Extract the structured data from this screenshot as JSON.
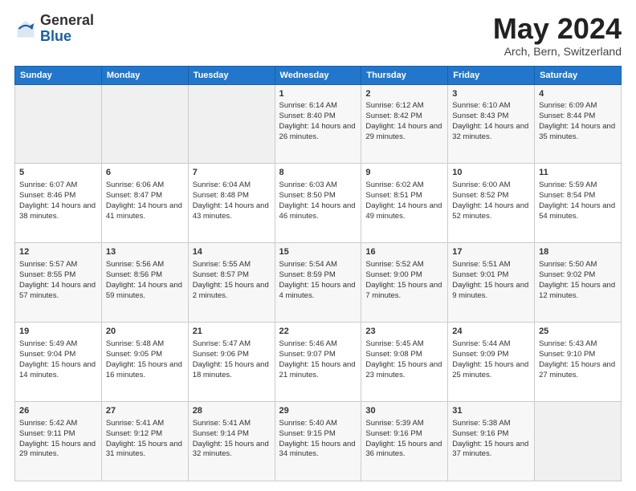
{
  "header": {
    "logo_general": "General",
    "logo_blue": "Blue",
    "month_title": "May 2024",
    "location": "Arch, Bern, Switzerland"
  },
  "days_of_week": [
    "Sunday",
    "Monday",
    "Tuesday",
    "Wednesday",
    "Thursday",
    "Friday",
    "Saturday"
  ],
  "weeks": [
    [
      {
        "day": "",
        "content": ""
      },
      {
        "day": "",
        "content": ""
      },
      {
        "day": "",
        "content": ""
      },
      {
        "day": "1",
        "content": "Sunrise: 6:14 AM\nSunset: 8:40 PM\nDaylight: 14 hours and 26 minutes."
      },
      {
        "day": "2",
        "content": "Sunrise: 6:12 AM\nSunset: 8:42 PM\nDaylight: 14 hours and 29 minutes."
      },
      {
        "day": "3",
        "content": "Sunrise: 6:10 AM\nSunset: 8:43 PM\nDaylight: 14 hours and 32 minutes."
      },
      {
        "day": "4",
        "content": "Sunrise: 6:09 AM\nSunset: 8:44 PM\nDaylight: 14 hours and 35 minutes."
      }
    ],
    [
      {
        "day": "5",
        "content": "Sunrise: 6:07 AM\nSunset: 8:46 PM\nDaylight: 14 hours and 38 minutes."
      },
      {
        "day": "6",
        "content": "Sunrise: 6:06 AM\nSunset: 8:47 PM\nDaylight: 14 hours and 41 minutes."
      },
      {
        "day": "7",
        "content": "Sunrise: 6:04 AM\nSunset: 8:48 PM\nDaylight: 14 hours and 43 minutes."
      },
      {
        "day": "8",
        "content": "Sunrise: 6:03 AM\nSunset: 8:50 PM\nDaylight: 14 hours and 46 minutes."
      },
      {
        "day": "9",
        "content": "Sunrise: 6:02 AM\nSunset: 8:51 PM\nDaylight: 14 hours and 49 minutes."
      },
      {
        "day": "10",
        "content": "Sunrise: 6:00 AM\nSunset: 8:52 PM\nDaylight: 14 hours and 52 minutes."
      },
      {
        "day": "11",
        "content": "Sunrise: 5:59 AM\nSunset: 8:54 PM\nDaylight: 14 hours and 54 minutes."
      }
    ],
    [
      {
        "day": "12",
        "content": "Sunrise: 5:57 AM\nSunset: 8:55 PM\nDaylight: 14 hours and 57 minutes."
      },
      {
        "day": "13",
        "content": "Sunrise: 5:56 AM\nSunset: 8:56 PM\nDaylight: 14 hours and 59 minutes."
      },
      {
        "day": "14",
        "content": "Sunrise: 5:55 AM\nSunset: 8:57 PM\nDaylight: 15 hours and 2 minutes."
      },
      {
        "day": "15",
        "content": "Sunrise: 5:54 AM\nSunset: 8:59 PM\nDaylight: 15 hours and 4 minutes."
      },
      {
        "day": "16",
        "content": "Sunrise: 5:52 AM\nSunset: 9:00 PM\nDaylight: 15 hours and 7 minutes."
      },
      {
        "day": "17",
        "content": "Sunrise: 5:51 AM\nSunset: 9:01 PM\nDaylight: 15 hours and 9 minutes."
      },
      {
        "day": "18",
        "content": "Sunrise: 5:50 AM\nSunset: 9:02 PM\nDaylight: 15 hours and 12 minutes."
      }
    ],
    [
      {
        "day": "19",
        "content": "Sunrise: 5:49 AM\nSunset: 9:04 PM\nDaylight: 15 hours and 14 minutes."
      },
      {
        "day": "20",
        "content": "Sunrise: 5:48 AM\nSunset: 9:05 PM\nDaylight: 15 hours and 16 minutes."
      },
      {
        "day": "21",
        "content": "Sunrise: 5:47 AM\nSunset: 9:06 PM\nDaylight: 15 hours and 18 minutes."
      },
      {
        "day": "22",
        "content": "Sunrise: 5:46 AM\nSunset: 9:07 PM\nDaylight: 15 hours and 21 minutes."
      },
      {
        "day": "23",
        "content": "Sunrise: 5:45 AM\nSunset: 9:08 PM\nDaylight: 15 hours and 23 minutes."
      },
      {
        "day": "24",
        "content": "Sunrise: 5:44 AM\nSunset: 9:09 PM\nDaylight: 15 hours and 25 minutes."
      },
      {
        "day": "25",
        "content": "Sunrise: 5:43 AM\nSunset: 9:10 PM\nDaylight: 15 hours and 27 minutes."
      }
    ],
    [
      {
        "day": "26",
        "content": "Sunrise: 5:42 AM\nSunset: 9:11 PM\nDaylight: 15 hours and 29 minutes."
      },
      {
        "day": "27",
        "content": "Sunrise: 5:41 AM\nSunset: 9:12 PM\nDaylight: 15 hours and 31 minutes."
      },
      {
        "day": "28",
        "content": "Sunrise: 5:41 AM\nSunset: 9:14 PM\nDaylight: 15 hours and 32 minutes."
      },
      {
        "day": "29",
        "content": "Sunrise: 5:40 AM\nSunset: 9:15 PM\nDaylight: 15 hours and 34 minutes."
      },
      {
        "day": "30",
        "content": "Sunrise: 5:39 AM\nSunset: 9:16 PM\nDaylight: 15 hours and 36 minutes."
      },
      {
        "day": "31",
        "content": "Sunrise: 5:38 AM\nSunset: 9:16 PM\nDaylight: 15 hours and 37 minutes."
      },
      {
        "day": "",
        "content": ""
      }
    ]
  ]
}
